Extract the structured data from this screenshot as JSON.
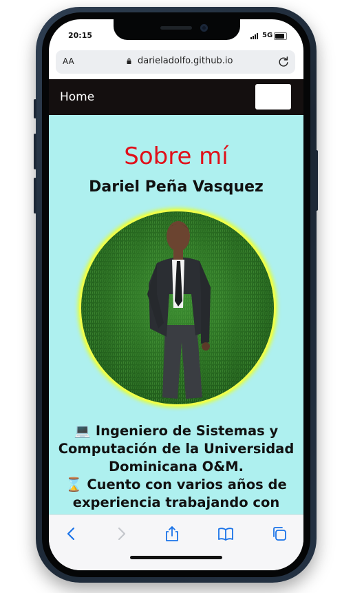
{
  "status_bar": {
    "time": "20:15",
    "network": "5G"
  },
  "browser": {
    "text_size_label": "AA",
    "url": "darieladolfo.github.io"
  },
  "navbar": {
    "home_label": "Home"
  },
  "page": {
    "title": "Sobre mí",
    "name": "Dariel Peña Vasquez",
    "bio_line1": "💻 Ingeniero de Sistemas y Computación de la Universidad Dominicana O&M.",
    "bio_line2": "⌛ Cuento con varios años de experiencia trabajando con"
  },
  "colors": {
    "content_bg": "#aef0ef",
    "title": "#e0101a",
    "navbar_bg": "#140f0f",
    "photo_ring": "#f0ff4a"
  },
  "icons": {
    "back": "chevron-left-icon",
    "forward": "chevron-right-icon",
    "share": "share-icon",
    "bookmarks": "book-icon",
    "tabs": "tabs-icon",
    "lock": "lock-icon",
    "reload": "reload-icon"
  }
}
